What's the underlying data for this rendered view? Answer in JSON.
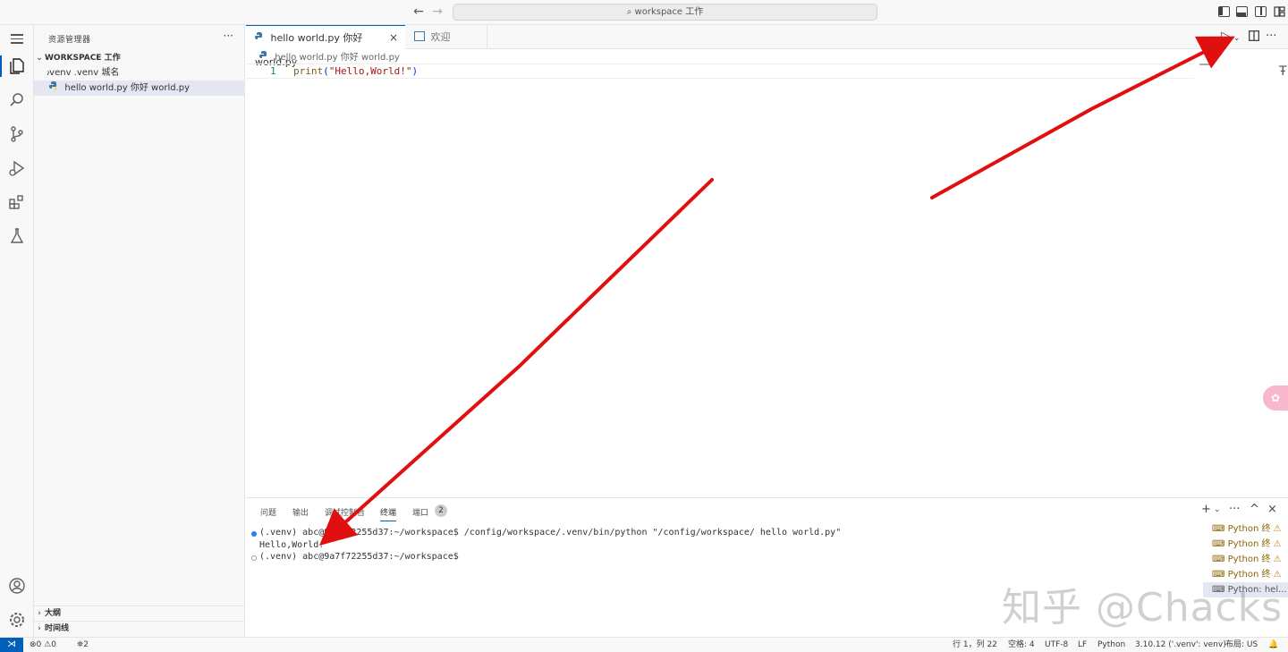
{
  "titlebar": {
    "back_icon": "arrow-left-icon",
    "forward_icon": "arrow-right-icon",
    "search_text": "workspace 工作"
  },
  "activitybar": {
    "items": [
      "explorer-icon",
      "search-icon",
      "source-control-icon",
      "run-debug-icon",
      "extensions-icon",
      "testing-icon"
    ],
    "bottom": [
      "account-icon",
      "settings-gear-icon"
    ]
  },
  "sidebar": {
    "title": "资源管理器",
    "more": "···",
    "workspace_label": "WORKSPACE 工作",
    "tree": [
      {
        "label": ".venv .venv 城名",
        "type": "folder"
      },
      {
        "label": "hello world.py 你好 world.py",
        "type": "python-file",
        "selected": true
      }
    ],
    "sections": [
      "大纲",
      "时间线"
    ]
  },
  "tabs": [
    {
      "label": "hello world.py 你好 world.py",
      "active": true,
      "close": "×"
    },
    {
      "label": "欢迎",
      "active": false
    }
  ],
  "editor": {
    "breadcrumb": "hello world.py 你好 world.py",
    "line_number": "1",
    "code": {
      "fn": "print",
      "open": "(",
      "str": "\"Hello,World!\"",
      "close": ")"
    }
  },
  "panel": {
    "tabs": [
      "问题",
      "输出",
      "调试控制台",
      "终端",
      "端口"
    ],
    "active_tab": "终端",
    "ports_badge": "2",
    "terminal_lines": [
      "(.venv) abc@9a7f72255d37:~/workspace$ /config/workspace/.venv/bin/python \"/config/workspace/ hello world.py\"",
      "Hello,World!",
      "(.venv) abc@9a7f72255d37:~/workspace$"
    ],
    "terminal_list": [
      {
        "label": "Python 终"
      },
      {
        "label": "Python 终"
      },
      {
        "label": "Python 终"
      },
      {
        "label": "Python 终"
      },
      {
        "label": "Python: hel..."
      }
    ],
    "actions": {
      "add": "+",
      "more": "···",
      "maximize": "^",
      "close": "×"
    }
  },
  "watermark": "知乎 @Chacks",
  "statusbar": {
    "errors": "0",
    "warnings": "0",
    "ports": "2",
    "position": "行 1，列 22",
    "spaces": "空格: 4",
    "encoding": "UTF-8",
    "eol": "LF",
    "language": "Python",
    "interpreter": "3.10.12 ('.venv': venv)",
    "layout": "布局: US"
  },
  "colors": {
    "accent": "#005fb8",
    "annotation_arrow": "#e01010",
    "warning": "#bf8803"
  }
}
